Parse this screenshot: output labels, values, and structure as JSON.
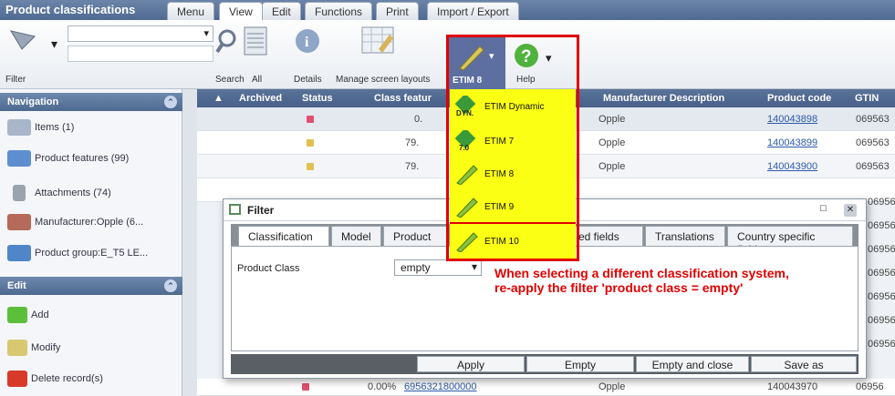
{
  "app": {
    "title": "Product classifications"
  },
  "menu_tabs": [
    "Menu",
    "View",
    "Edit",
    "Functions",
    "Print",
    "Import / Export"
  ],
  "ribbon": {
    "filter_label": "Filter",
    "search_label": "Search",
    "all_label": "All",
    "details_label": "Details",
    "manage_label": "Manage screen layouts",
    "etim_label": "ETIM 8",
    "help_label": "Help"
  },
  "sidebar": {
    "nav_title": "Navigation",
    "nav_items": [
      "Items (1)",
      "Product features (99)",
      "Attachments (74)",
      "Manufacturer:Opple (6...",
      "Product group:E_T5 LE..."
    ],
    "edit_title": "Edit",
    "edit_items": [
      "Add",
      "Modify",
      "Delete record(s)"
    ]
  },
  "grid": {
    "columns": [
      "Archived",
      "Status",
      "Class featur",
      "Manufacturer Description",
      "Product code",
      "GTIN"
    ],
    "rows": [
      {
        "percent": "0.",
        "manufacturer": "Opple",
        "product_code": "140043898",
        "gtin": "069563",
        "status_color": "#e05070"
      },
      {
        "percent": "79.",
        "manufacturer": "Opple",
        "product_code": "140043899",
        "gtin": "069563",
        "status_color": "#e0c050"
      },
      {
        "percent": "79.",
        "manufacturer": "Opple",
        "product_code": "140043900",
        "gtin": "069563",
        "status_color": "#e0c050"
      }
    ],
    "partial_gtins": [
      "06956",
      "06956",
      "06956",
      "06956",
      "06956",
      "06956",
      "06956"
    ],
    "last_row": {
      "percent": "0.00%",
      "code_link": "6956321800000",
      "manufacturer": "Opple",
      "product_code": "140043970",
      "gtin": "06956"
    }
  },
  "etim_menu": {
    "items": [
      "ETIM Dynamic",
      "ETIM 7",
      "ETIM 8",
      "ETIM 9",
      "ETIM 10"
    ],
    "dyn_badge": "DYN.",
    "seven_badge": "7.0"
  },
  "filter": {
    "title": "Filter",
    "tabs": [
      "Classification",
      "Model",
      "Product",
      "ed fields",
      "Translations",
      "Country specific fields"
    ],
    "product_class_label": "Product Class",
    "product_class_value": "empty",
    "buttons": [
      "Apply",
      "Empty",
      "Empty and close",
      "Save as"
    ]
  },
  "note": "When selecting a different classification system, re-apply the filter 'product class = empty'"
}
